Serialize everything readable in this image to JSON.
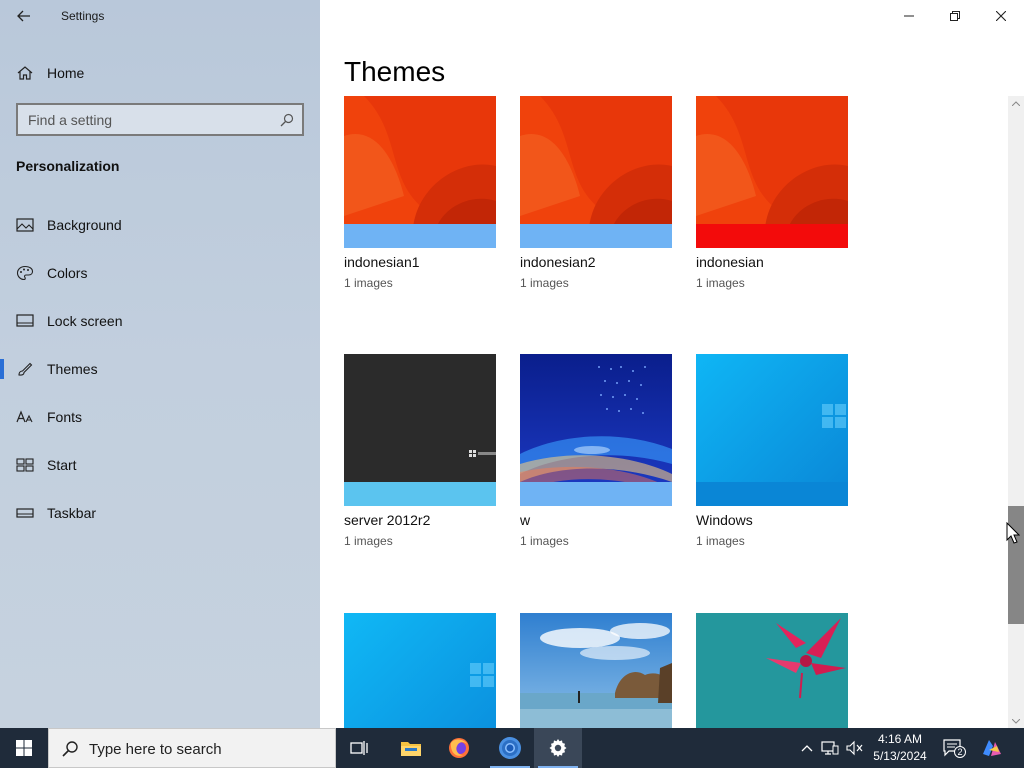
{
  "window": {
    "app_title": "Settings",
    "back_label": "Back",
    "minimize": "Minimize",
    "maximize": "Restore",
    "close": "Close"
  },
  "sidebar": {
    "home_label": "Home",
    "search_placeholder": "Find a setting",
    "section_title": "Personalization",
    "items": [
      {
        "label": "Background",
        "icon": "picture-icon"
      },
      {
        "label": "Colors",
        "icon": "palette-icon"
      },
      {
        "label": "Lock screen",
        "icon": "lock-screen-icon"
      },
      {
        "label": "Themes",
        "icon": "brush-icon",
        "active": true
      },
      {
        "label": "Fonts",
        "icon": "font-icon"
      },
      {
        "label": "Start",
        "icon": "start-grid-icon"
      },
      {
        "label": "Taskbar",
        "icon": "taskbar-icon"
      }
    ]
  },
  "main": {
    "title": "Themes",
    "themes": [
      {
        "name": "indonesian1",
        "count": "1 images",
        "accent": "#6fb3f4"
      },
      {
        "name": "indonesian2",
        "count": "1 images",
        "accent": "#6fb3f4"
      },
      {
        "name": "indonesian",
        "count": "1 images",
        "accent": "#f30b0b"
      },
      {
        "name": "server 2012r2",
        "count": "1 images",
        "accent": "#5bc4ef"
      },
      {
        "name": "w",
        "count": "1 images",
        "accent": "#6fb3f4"
      },
      {
        "name": "Windows",
        "count": "1 images",
        "accent": "#0a86d6"
      },
      {
        "name": "",
        "count": "",
        "accent": ""
      },
      {
        "name": "",
        "count": "",
        "accent": ""
      },
      {
        "name": "",
        "count": "",
        "accent": ""
      }
    ]
  },
  "taskbar": {
    "search_placeholder": "Type here to search",
    "time": "4:16 AM",
    "date": "5/13/2024",
    "notification_count": "2"
  },
  "colors": {
    "taskbar_bg": "#1f2b3a",
    "accent_blue": "#2a6fd6"
  }
}
